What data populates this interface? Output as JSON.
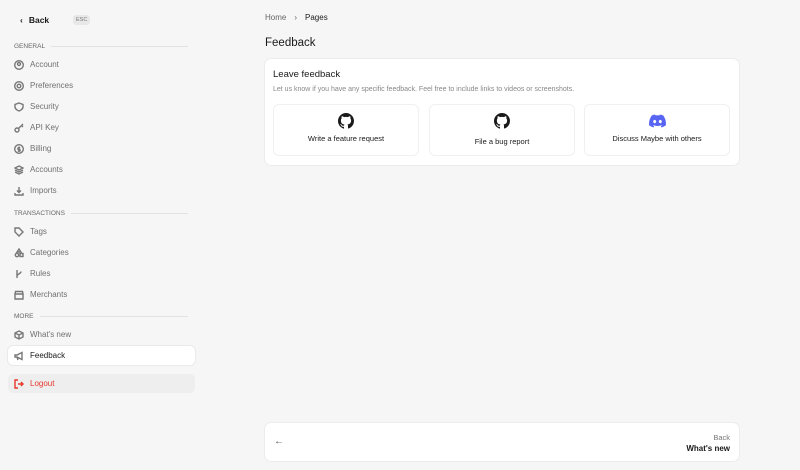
{
  "sidebar": {
    "back_label": "Back",
    "esc_label": "ESC",
    "sections": {
      "general": "GENERAL",
      "transactions": "TRANSACTIONS",
      "more": "MORE"
    },
    "items": [
      "Account",
      "Preferences",
      "Security",
      "API Key",
      "Billing",
      "Accounts",
      "Imports",
      "Tags",
      "Categories",
      "Rules",
      "Merchants",
      "What's new",
      "Feedback",
      "Logout"
    ]
  },
  "breadcrumb": {
    "home": "Home",
    "current": "Pages"
  },
  "page_title": "Feedback",
  "card": {
    "title": "Leave feedback",
    "description": "Let us know if you have any specific feedback. Feel free to include links to videos or screenshots.",
    "options": [
      "Write a feature request",
      "File a bug report",
      "Discuss Maybe with others"
    ]
  },
  "footer": {
    "label": "Back",
    "target": "What's new"
  },
  "colors": {
    "discord": "#5865f2",
    "logout": "#e5372b"
  }
}
